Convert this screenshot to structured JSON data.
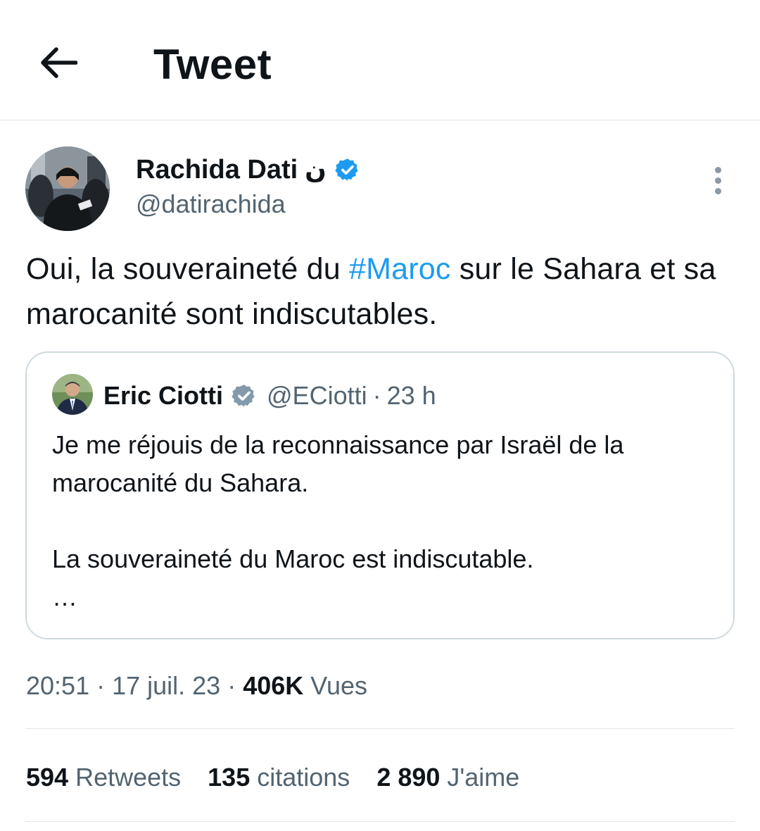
{
  "header": {
    "title": "Tweet",
    "back_icon": "arrow-left-icon"
  },
  "tweet": {
    "author": {
      "name": "Rachida Dati",
      "name_suffix": "ن",
      "handle": "@datirachida",
      "verified": true
    },
    "text": {
      "before": "Oui, la souveraineté du ",
      "hashtag": "#Maroc",
      "after": " sur le Sahara et sa marocanité sont indiscutables."
    },
    "quote": {
      "author": {
        "name": "Eric Ciotti",
        "handle": "@ECiotti",
        "separator": "·",
        "time": "23 h",
        "verified": true
      },
      "paragraph1": "Je me réjouis de la reconnaissance par Israël de la marocanité du Sahara.",
      "paragraph2": "La souveraineté du Maroc est indiscutable.",
      "ellipsis": "…"
    },
    "meta": {
      "time": "20:51",
      "separator": " · ",
      "date": "17 juil. 23",
      "views_count": "406K",
      "views_label": "Vues"
    },
    "stats": [
      {
        "count": "594",
        "label": "Retweets"
      },
      {
        "count": "135",
        "label": "citations"
      },
      {
        "count": "2 890",
        "label": "J'aime"
      }
    ]
  },
  "colors": {
    "accent": "#1d9bf0",
    "text_primary": "#0f1419",
    "text_secondary": "#536471",
    "border": "#cfd9de",
    "divider": "#e1e5e8"
  }
}
